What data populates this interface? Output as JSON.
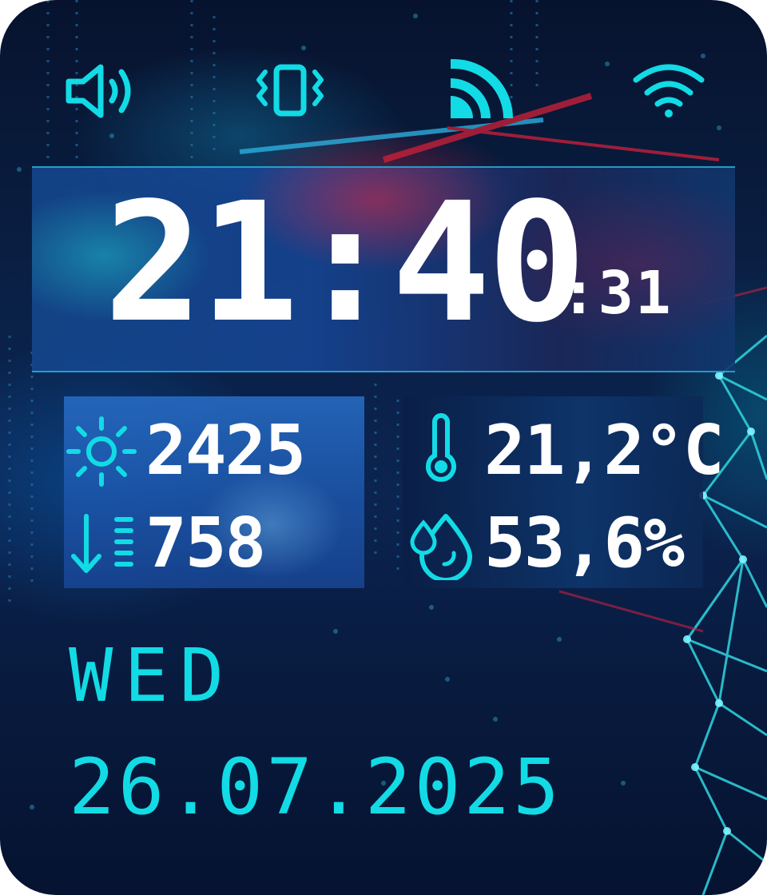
{
  "status_bar": {
    "icons": [
      "speaker-icon",
      "vibrate-icon",
      "signal-icon",
      "wifi-icon"
    ]
  },
  "clock": {
    "time": "21:40",
    "seconds": ":31"
  },
  "sensors": {
    "light": {
      "icon": "sun-icon",
      "value": "2425"
    },
    "pressure": {
      "icon": "pressure-icon",
      "value": "758"
    },
    "temperature": {
      "icon": "thermometer-icon",
      "value": "21,2°C"
    },
    "humidity": {
      "icon": "drop-icon",
      "value": "53,6%"
    }
  },
  "date": {
    "day": "WED",
    "full": "26.07.2025"
  },
  "colors": {
    "accent": "#12dbe5",
    "digits": "#ffffff",
    "background": "#0a2147"
  }
}
